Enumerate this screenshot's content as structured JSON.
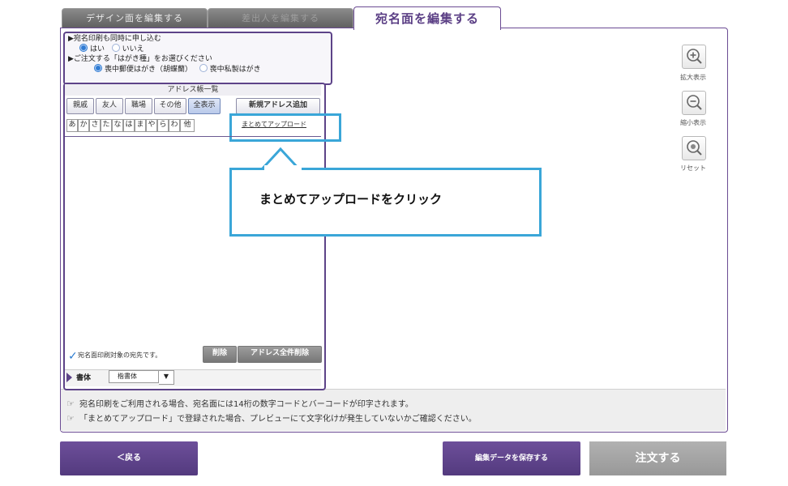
{
  "tabs": [
    {
      "label": "デザイン面を編集する"
    },
    {
      "label": "差出人を編集する"
    },
    {
      "label": "宛名面を編集する"
    }
  ],
  "options": {
    "q1": "▶宛名印刷も同時に申し込む",
    "q1_yes": "はい",
    "q1_no": "いいえ",
    "q2": "▶ご注文する「はがき種」をお選びください",
    "q2_a": "喪中郵便はがき（胡蝶蘭）",
    "q2_b": "喪中私製はがき"
  },
  "address_book": {
    "title": "アドレス帳一覧",
    "categories": [
      "親戚",
      "友人",
      "職場",
      "その他",
      "全表示"
    ],
    "add_button": "新規アドレス追加",
    "kana": [
      "あ",
      "か",
      "さ",
      "た",
      "な",
      "は",
      "ま",
      "や",
      "ら",
      "わ",
      "他"
    ],
    "upload_link": "まとめてアップロード",
    "note": "宛名面印刷対象の宛先です。",
    "delete_button": "削除",
    "delete_all_button": "アドレス全件削除",
    "font_label": "書体",
    "font_value": "楷書体",
    "font_arrow": "▼"
  },
  "callout": {
    "text": "まとめてアップロードをクリック"
  },
  "zoom": {
    "in_label": "拡大表示",
    "out_label": "縮小表示",
    "reset_label": "リセット"
  },
  "info": [
    "宛名印刷をご利用される場合、宛名面には14桁の数字コードとバーコードが印字されます。",
    "「まとめてアップロード」で登録された場合、プレビューにて文字化けが発生していないかご確認ください。"
  ],
  "buttons": {
    "back": "＜戻る",
    "save": "編集データを保存する",
    "order": "注文する"
  },
  "colors": {
    "accent": "#5d4388",
    "highlight": "#3aa6d8"
  }
}
